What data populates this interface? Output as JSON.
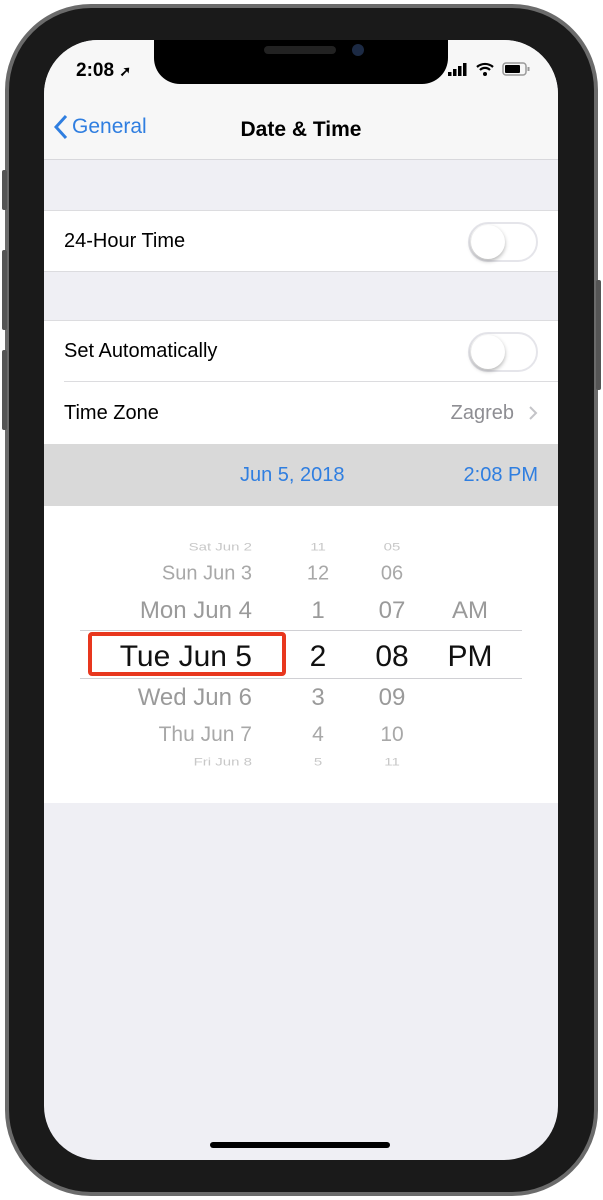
{
  "status_bar": {
    "time": "2:08",
    "icons": [
      "location-arrow-icon",
      "signal-icon",
      "wifi-icon",
      "battery-icon"
    ]
  },
  "nav": {
    "back_label": "General",
    "title": "Date & Time"
  },
  "settings": {
    "hour24": {
      "label": "24-Hour Time",
      "on": false
    },
    "set_automatically": {
      "label": "Set Automatically",
      "on": false
    },
    "time_zone": {
      "label": "Time Zone",
      "value": "Zagreb"
    }
  },
  "selected": {
    "date": "Jun 5, 2018",
    "time": "2:08 PM"
  },
  "picker": {
    "dates": [
      "Sat Jun 2",
      "Sun Jun 3",
      "Mon Jun 4",
      "Tue Jun 5",
      "Wed Jun 6",
      "Thu Jun 7",
      "Fri Jun 8"
    ],
    "hours": [
      "11",
      "12",
      "1",
      "2",
      "3",
      "4",
      "5"
    ],
    "minutes": [
      "05",
      "06",
      "07",
      "08",
      "09",
      "10",
      "11"
    ],
    "ampm": [
      "AM",
      "PM"
    ],
    "selected_index": 3
  },
  "colors": {
    "accent": "#2f7ee0",
    "highlight": "#e8371e"
  }
}
